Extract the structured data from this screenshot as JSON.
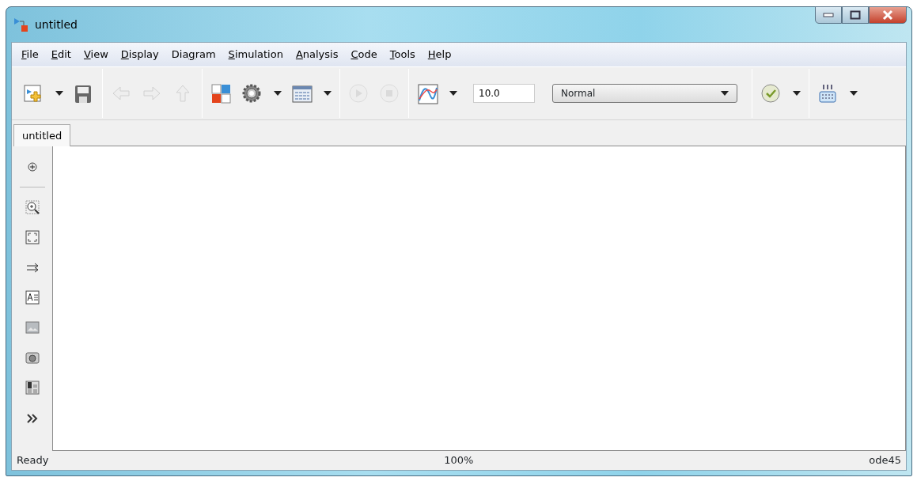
{
  "window": {
    "title": "untitled"
  },
  "menu": [
    {
      "key": "F",
      "after": "ile"
    },
    {
      "key": "E",
      "after": "dit"
    },
    {
      "key": "V",
      "after": "iew"
    },
    {
      "key": "D",
      "after": "isplay"
    },
    {
      "before": "Dia",
      "key": "g",
      "after": "ram"
    },
    {
      "key": "S",
      "after": "imulation"
    },
    {
      "key": "A",
      "after": "nalysis"
    },
    {
      "key": "C",
      "after": "ode"
    },
    {
      "key": "T",
      "after": "ools"
    },
    {
      "key": "H",
      "after": "elp"
    }
  ],
  "toolbar": [
    {
      "kind": "new",
      "dropdown": true,
      "disabled": false
    },
    {
      "kind": "save",
      "dropdown": false,
      "disabled": false
    },
    {
      "kind": "sep"
    },
    {
      "kind": "back",
      "dropdown": false,
      "disabled": true
    },
    {
      "kind": "forward",
      "dropdown": false,
      "disabled": true
    },
    {
      "kind": "up",
      "dropdown": false,
      "disabled": true
    },
    {
      "kind": "sep"
    },
    {
      "kind": "library",
      "dropdown": false,
      "disabled": false
    },
    {
      "kind": "gear",
      "dropdown": true,
      "disabled": false
    },
    {
      "kind": "explorer",
      "dropdown": true,
      "disabled": false
    },
    {
      "kind": "sep"
    },
    {
      "kind": "run",
      "dropdown": false,
      "disabled": true
    },
    {
      "kind": "stop",
      "dropdown": false,
      "disabled": true
    },
    {
      "kind": "sep"
    },
    {
      "kind": "scope",
      "dropdown": true,
      "disabled": false
    },
    {
      "kind": "stoptime",
      "value": "10.0"
    },
    {
      "kind": "mode",
      "value": "Normal"
    },
    {
      "kind": "sep"
    },
    {
      "kind": "check",
      "dropdown": true,
      "disabled": false
    },
    {
      "kind": "sep"
    },
    {
      "kind": "build",
      "dropdown": true,
      "disabled": false
    }
  ],
  "tabs": [
    {
      "label": "untitled",
      "selected": true
    }
  ],
  "palette": [
    {
      "kind": "hide"
    },
    {
      "kind": "rule"
    },
    {
      "kind": "zoom"
    },
    {
      "kind": "fit"
    },
    {
      "kind": "arrows"
    },
    {
      "kind": "annotation"
    },
    {
      "kind": "image"
    },
    {
      "kind": "camera"
    },
    {
      "kind": "area"
    },
    {
      "kind": "more"
    }
  ],
  "status_bar": {
    "left": "Ready",
    "center": "100%",
    "right": "ode45"
  }
}
